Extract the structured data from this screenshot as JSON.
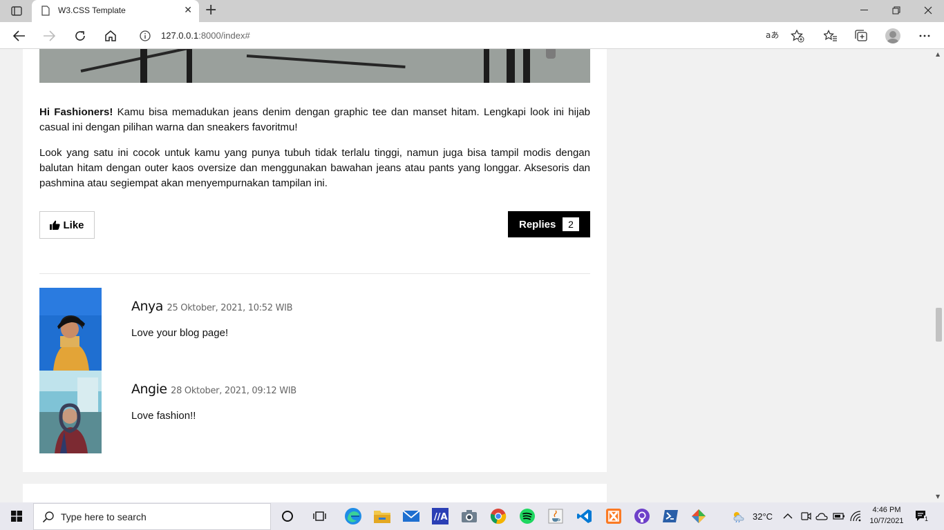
{
  "browser": {
    "tab_title": "W3.CSS Template",
    "url_host": "127.0.0.1",
    "url_rest": ":8000/index#"
  },
  "post": {
    "intro_bold": "Hi Fashioners!",
    "intro_text": " Kamu bisa memadukan jeans denim dengan graphic tee dan manset hitam. Lengkapi look ini hijab casual ini dengan pilihan warna dan sneakers favoritmu!",
    "paragraph2": "Look yang satu ini cocok untuk kamu yang punya tubuh tidak terlalu tinggi, namun juga bisa tampil modis dengan balutan hitam dengan outer kaos oversize dan menggunakan bawahan jeans atau pants yang longgar. Aksesoris dan pashmina atau segiempat akan menyempurnakan tampilan ini.",
    "like_label": "Like",
    "replies_label": "Replies",
    "replies_count": "2"
  },
  "comments": [
    {
      "name": "Anya",
      "date": "25 Oktober, 2021, 10:52 WIB",
      "text": "Love your blog page!"
    },
    {
      "name": "Angie",
      "date": "28 Oktober, 2021, 09:12 WIB",
      "text": "Love fashion!!"
    }
  ],
  "taskbar": {
    "search_placeholder": "Type here to search",
    "weather": "32°C",
    "time": "4:46 PM",
    "date": "10/7/2021",
    "notification_count": "1"
  },
  "colors": {
    "page_bg": "#f1f1f1",
    "card_bg": "#ffffff",
    "replies_bg": "#000000"
  }
}
